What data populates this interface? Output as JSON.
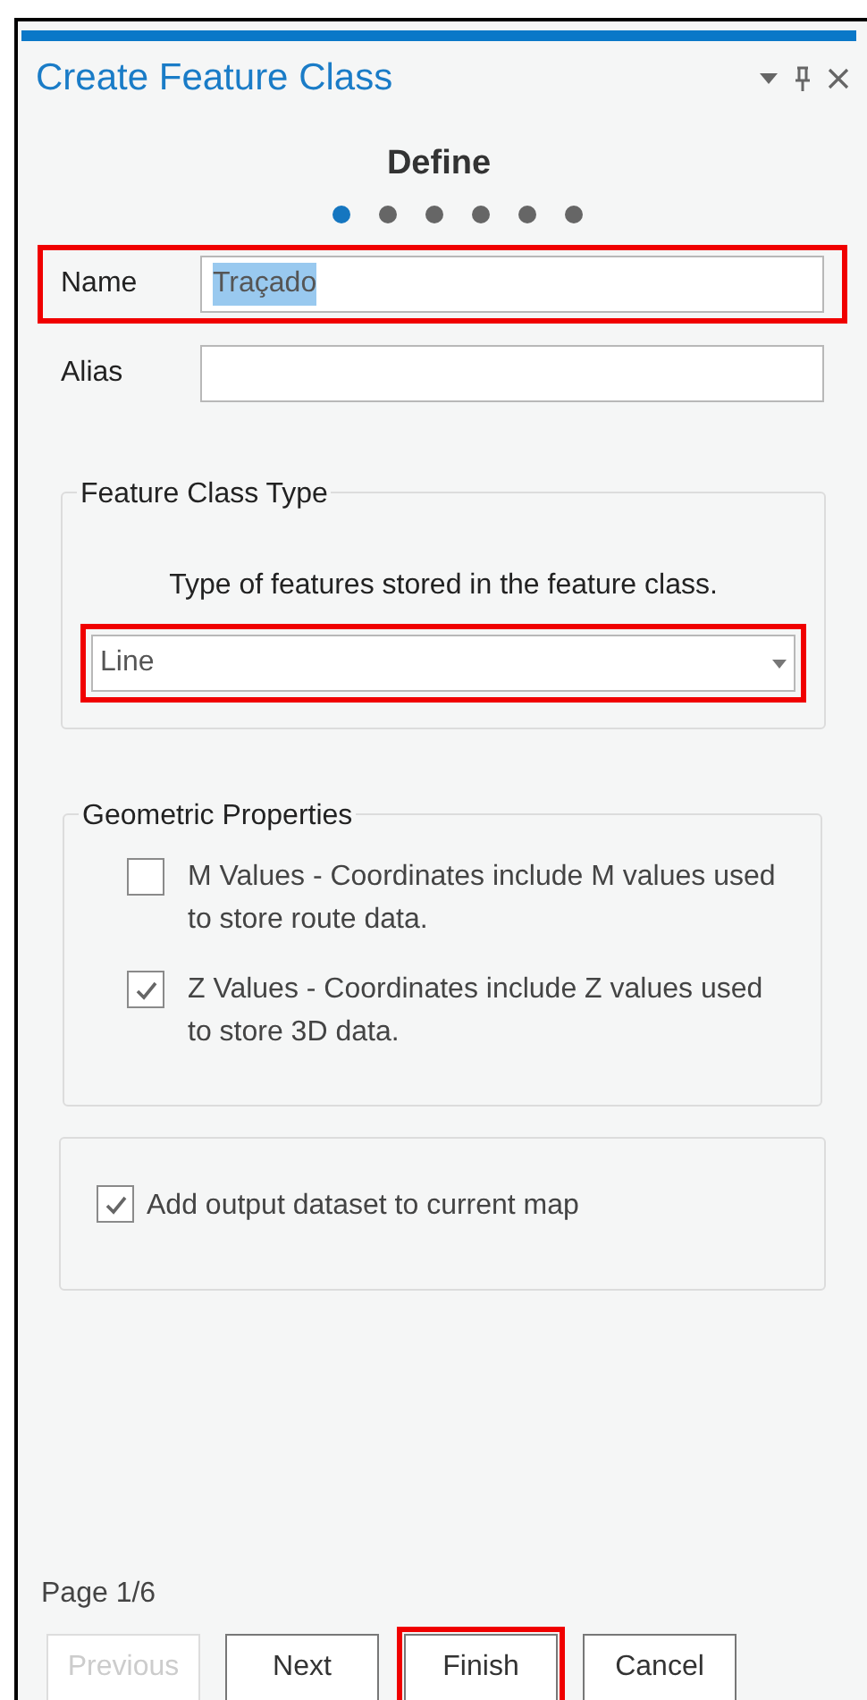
{
  "panel": {
    "title": "Create Feature Class",
    "step_title": "Define",
    "steps": [
      {
        "selected": true
      },
      {
        "selected": false
      },
      {
        "selected": false
      },
      {
        "selected": false
      },
      {
        "selected": false
      },
      {
        "selected": false
      }
    ]
  },
  "fields": [
    {
      "label": "Name",
      "value": "Traçado",
      "value_selected": true,
      "highlighted": true
    },
    {
      "label": "Alias",
      "highlighted": false
    }
  ],
  "feature_class_type": {
    "legend": "Feature Class Type",
    "description": "Type of features stored in the feature class.",
    "dropdown": {
      "value": "Line",
      "highlighted": true
    }
  },
  "geometric_properties": {
    "legend": "Geometric Properties",
    "options": [
      {
        "label": "M Values - Coordinates include M values used to store route data.",
        "checked": false
      },
      {
        "label": "Z Values - Coordinates include Z values used to store 3D data.",
        "checked": true
      }
    ]
  },
  "add_to_map": {
    "label": "Add output dataset to current map",
    "checked": true
  },
  "page_indicator": "Page 1/6",
  "buttons": [
    {
      "label": "Previous",
      "disabled": true,
      "highlighted": false
    },
    {
      "label": "Next",
      "disabled": false,
      "highlighted": false
    },
    {
      "label": "Finish",
      "disabled": false,
      "highlighted": true
    },
    {
      "label": "Cancel",
      "disabled": false,
      "highlighted": false
    }
  ]
}
